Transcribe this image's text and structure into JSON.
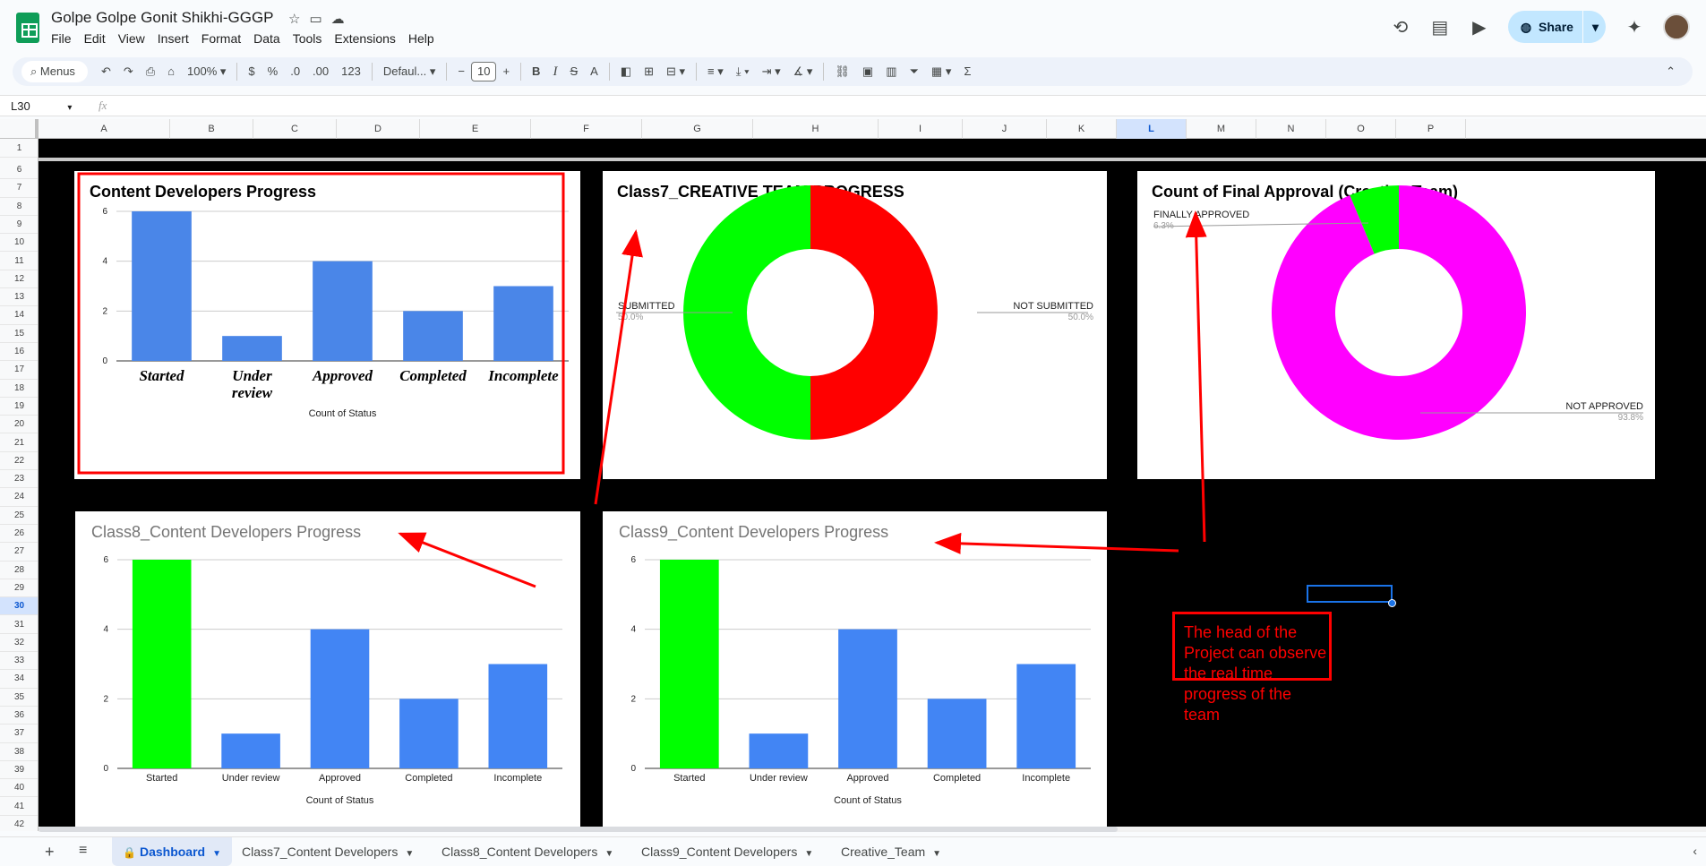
{
  "app": {
    "doc_title": "Golpe Golpe Gonit Shikhi-GGGP",
    "menu": [
      "File",
      "Edit",
      "View",
      "Insert",
      "Format",
      "Data",
      "Tools",
      "Extensions",
      "Help"
    ],
    "share_label": "Share"
  },
  "toolbar": {
    "menus_label": "Menus",
    "zoom": "100%",
    "currency": "$",
    "percent": "%",
    "dec_decrease": ".0",
    "dec_increase": ".00",
    "number_format": "123",
    "font": "Defaul...",
    "font_size": "10",
    "bold": "B",
    "italic": "I",
    "strike": "S",
    "text_color": "A"
  },
  "formula_bar": {
    "name_box": "L30",
    "fx": "fx"
  },
  "columns": [
    "A",
    "B",
    "C",
    "D",
    "E",
    "F",
    "G",
    "H",
    "I",
    "J",
    "K",
    "L",
    "M",
    "N",
    "O",
    "P"
  ],
  "selected_column": "L",
  "rows": [
    "1",
    "6",
    "7",
    "8",
    "9",
    "10",
    "11",
    "12",
    "13",
    "14",
    "15",
    "16",
    "17",
    "18",
    "19",
    "20",
    "21",
    "22",
    "23",
    "24",
    "25",
    "26",
    "27",
    "28",
    "29",
    "30",
    "31",
    "32",
    "33",
    "34",
    "35",
    "36",
    "37",
    "38",
    "39",
    "40",
    "41",
    "42"
  ],
  "selected_row": "30",
  "chart_data": [
    {
      "type": "bar",
      "title": "Content Developers Progress",
      "xlabel": "Count of Status",
      "categories": [
        "Started",
        "Under review",
        "Approved",
        "Completed",
        "Incomplete"
      ],
      "values": [
        6,
        1,
        4,
        2,
        3
      ],
      "ylim": [
        0,
        6
      ],
      "yticks": [
        "0",
        "2",
        "4",
        "6"
      ],
      "colors": [
        "#4a86e8",
        "#4a86e8",
        "#4a86e8",
        "#4a86e8",
        "#4a86e8"
      ],
      "highlight_border": "#ff0000"
    },
    {
      "type": "pie",
      "title": "Class7_CREATIVE TEAM PROGRESS",
      "donut": true,
      "labels": [
        "NOT SUBMITTED",
        "SUBMITTED"
      ],
      "values": [
        50.0,
        50.0
      ],
      "percent_labels": [
        "50.0%",
        "50.0%"
      ],
      "colors": [
        "#ff0000",
        "#00ff00"
      ]
    },
    {
      "type": "pie",
      "title": "Count of Final Approval (Creative Team)",
      "donut": true,
      "labels": [
        "NOT APPROVED",
        "FINALLY APPROVED"
      ],
      "values": [
        93.8,
        6.3
      ],
      "percent_labels": [
        "93.8%",
        "6.3%"
      ],
      "colors": [
        "#ff00ff",
        "#00ff00"
      ]
    },
    {
      "type": "bar",
      "title": "Class8_Content Developers Progress",
      "xlabel": "Count of Status",
      "categories": [
        "Started",
        "Under review",
        "Approved",
        "Completed",
        "Incomplete"
      ],
      "values": [
        6,
        1,
        4,
        2,
        3
      ],
      "ylim": [
        0,
        6
      ],
      "yticks": [
        "0",
        "2",
        "4",
        "6"
      ],
      "colors": [
        "#00ff00",
        "#4285f4",
        "#4285f4",
        "#4285f4",
        "#4285f4"
      ]
    },
    {
      "type": "bar",
      "title": "Class9_Content Developers Progress",
      "xlabel": "Count of Status",
      "categories": [
        "Started",
        "Under review",
        "Approved",
        "Completed",
        "Incomplete"
      ],
      "values": [
        6,
        1,
        4,
        2,
        3
      ],
      "ylim": [
        0,
        6
      ],
      "yticks": [
        "0",
        "2",
        "4",
        "6"
      ],
      "colors": [
        "#00ff00",
        "#4285f4",
        "#4285f4",
        "#4285f4",
        "#4285f4"
      ]
    }
  ],
  "annotation": {
    "text": "The head of the Project can observe the real time progress of the team",
    "color": "#ff0000"
  },
  "sheet_tabs": {
    "active": "Dashboard",
    "items": [
      "Dashboard",
      "Class7_Content Developers",
      "Class8_Content Developers",
      "Class9_Content Developers",
      "Creative_Team"
    ]
  }
}
